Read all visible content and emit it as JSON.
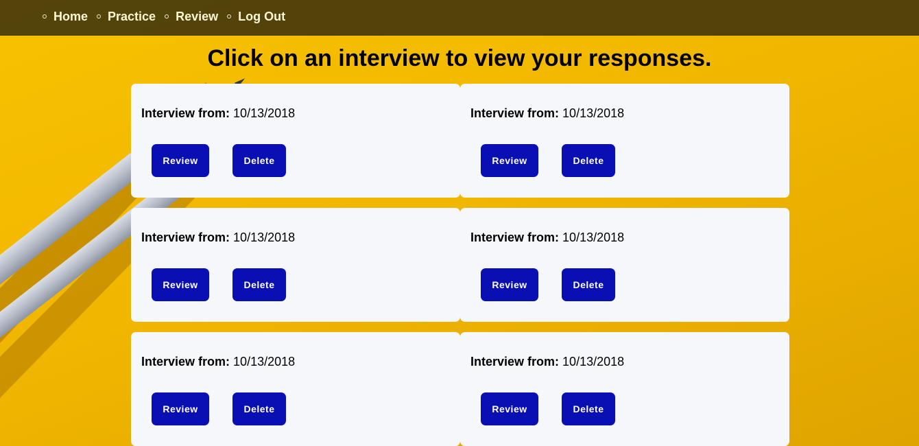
{
  "nav": {
    "items": [
      {
        "label": "Home"
      },
      {
        "label": "Practice"
      },
      {
        "label": "Review"
      },
      {
        "label": "Log Out"
      }
    ]
  },
  "page": {
    "title": "Click on an interview to view your responses."
  },
  "interviews": [
    {
      "label": "Interview from:",
      "date": "10/13/2018",
      "review_label": "Review",
      "delete_label": "Delete"
    },
    {
      "label": "Interview from:",
      "date": "10/13/2018",
      "review_label": "Review",
      "delete_label": "Delete"
    },
    {
      "label": "Interview from:",
      "date": "10/13/2018",
      "review_label": "Review",
      "delete_label": "Delete"
    },
    {
      "label": "Interview from:",
      "date": "10/13/2018",
      "review_label": "Review",
      "delete_label": "Delete"
    },
    {
      "label": "Interview from:",
      "date": "10/13/2018",
      "review_label": "Review",
      "delete_label": "Delete"
    },
    {
      "label": "Interview from:",
      "date": "10/13/2018",
      "review_label": "Review",
      "delete_label": "Delete"
    }
  ],
  "colors": {
    "background": "#f2b800",
    "navbar": "#3c320a",
    "button": "#0a0fb3",
    "card": "#f6f7fb"
  }
}
